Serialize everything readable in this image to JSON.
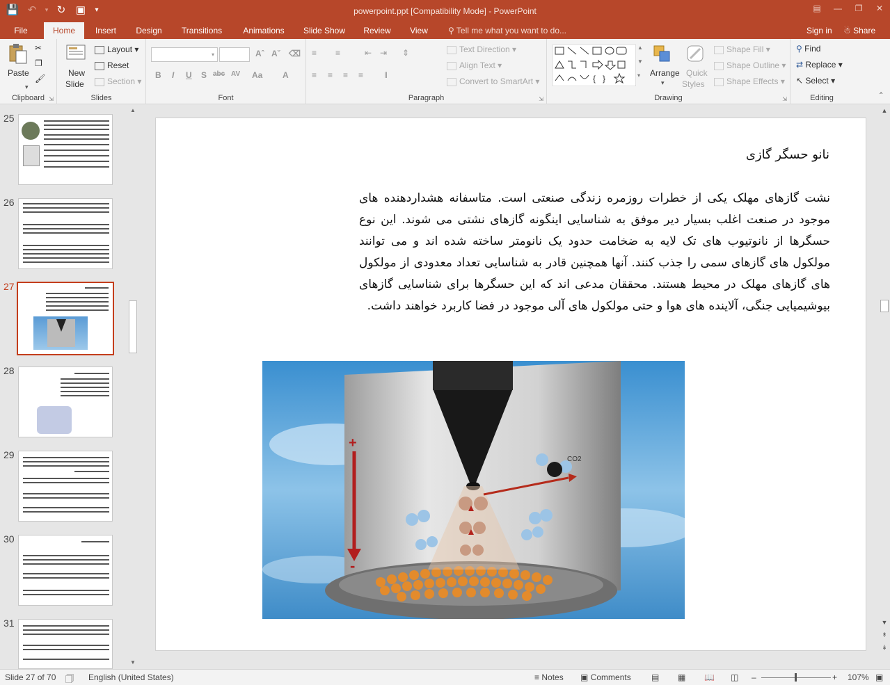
{
  "window": {
    "title": "powerpoint.ppt [Compatibility Mode] - PowerPoint",
    "controls": [
      "ribbon-display-icon",
      "minimize-icon",
      "restore-icon",
      "close-icon"
    ]
  },
  "tabs": [
    {
      "label": "File",
      "active": false
    },
    {
      "label": "Home",
      "active": true
    },
    {
      "label": "Insert",
      "active": false
    },
    {
      "label": "Design",
      "active": false
    },
    {
      "label": "Transitions",
      "active": false
    },
    {
      "label": "Animations",
      "active": false
    },
    {
      "label": "Slide Show",
      "active": false
    },
    {
      "label": "Review",
      "active": false
    },
    {
      "label": "View",
      "active": false
    }
  ],
  "tell_me": "Tell me what you want to do...",
  "signin": "Sign in",
  "share": "Share",
  "ribbon": {
    "clipboard": {
      "label": "Clipboard",
      "paste": "Paste"
    },
    "slides": {
      "label": "Slides",
      "new_slide": "New",
      "new_slide2": "Slide",
      "layout": "Layout",
      "reset": "Reset",
      "section": "Section"
    },
    "font": {
      "label": "Font"
    },
    "paragraph": {
      "label": "Paragraph",
      "text_direction": "Text Direction",
      "align_text": "Align Text",
      "convert_smartart": "Convert to SmartArt"
    },
    "drawing": {
      "label": "Drawing",
      "arrange": "Arrange",
      "quick_styles": "Quick",
      "quick_styles2": "Styles",
      "shape_fill": "Shape Fill",
      "shape_outline": "Shape Outline",
      "shape_effects": "Shape Effects"
    },
    "editing": {
      "label": "Editing",
      "find": "Find",
      "replace": "Replace",
      "select": "Select"
    }
  },
  "thumbnails": [
    {
      "number": "25",
      "active": false
    },
    {
      "number": "26",
      "active": false
    },
    {
      "number": "27",
      "active": true
    },
    {
      "number": "28",
      "active": false
    },
    {
      "number": "29",
      "active": false
    },
    {
      "number": "30",
      "active": false
    },
    {
      "number": "31",
      "active": false
    }
  ],
  "slide": {
    "title": "نانو حسگر گازی",
    "body": " نشت گازهای مهلک یکی از خطرات روزمره زندگی صنعتی است. متاسفانه هشداردهنده های موجود در صنعت اغلب بسیار دیر موفق به شناسایی اینگونه گازهای نشتی می شوند. این نوع حسگرها از نانوتیوب های تک لایه به ضخامت حدود یک نانومتر ساخته شده اند و می توانند مولکول های گازهای سمی را جذب کنند. آنها همچنین قادر به شناسایی تعداد معدودی از مولکول های گازهای مهلک در محیط هستند. محققان مدعی اند که این حسگرها برای شناسایی گازهای بیوشیمیایی جنگی، آلاینده های هوا و حتی مولکول های آلی موجود در فضا کاربرد خواهند داشت.",
    "image": {
      "label_co2": "CO2",
      "plus": "+",
      "minus": "-"
    }
  },
  "status": {
    "slide_info": "Slide 27 of 70",
    "language": "English (United States)",
    "notes": "Notes",
    "comments": "Comments",
    "zoom": "107%"
  },
  "colors": {
    "accent": "#b7472a",
    "active_thumb": "#c43e1c"
  }
}
